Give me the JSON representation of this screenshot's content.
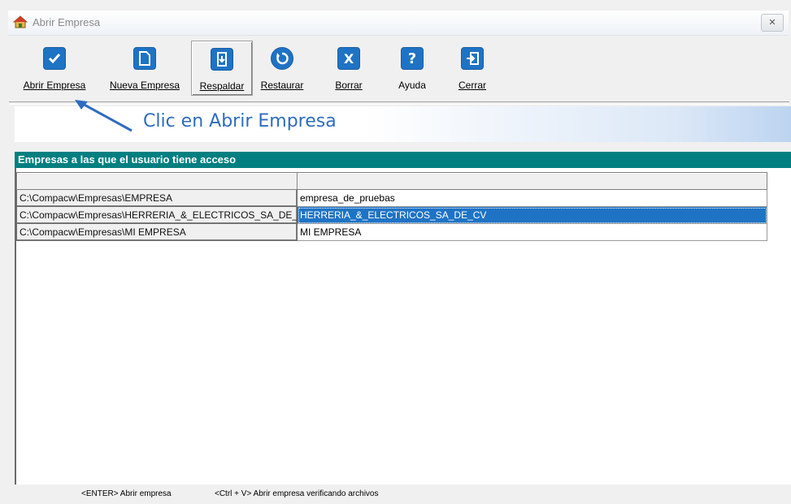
{
  "window": {
    "title": "Abrir Empresa",
    "close_label": "✕"
  },
  "toolbar": {
    "buttons": [
      {
        "label": "Abrir Empresa",
        "icon": "check-icon"
      },
      {
        "label": "Nueva Empresa",
        "icon": "new-document-icon"
      },
      {
        "label": "Respaldar",
        "icon": "backup-icon"
      },
      {
        "label": "Restaurar",
        "icon": "restore-icon"
      },
      {
        "label": "Borrar",
        "icon": "delete-icon"
      },
      {
        "label": "Ayuda",
        "icon": "help-icon"
      },
      {
        "label": "Cerrar",
        "icon": "exit-icon"
      }
    ]
  },
  "annotation": {
    "text": "Clic en Abrir Empresa"
  },
  "panel": {
    "title": "Empresas a las que el usuario tiene acceso"
  },
  "table": {
    "columns": [
      "",
      ""
    ],
    "rows": [
      {
        "path": "C:\\Compacw\\Empresas\\EMPRESA",
        "name": "empresa_de_pruebas",
        "selected": false
      },
      {
        "path": "C:\\Compacw\\Empresas\\HERRERIA_&_ELECTRICOS_SA_DE_CV",
        "name": "HERRERIA_&_ELECTRICOS_SA_DE_CV",
        "selected": true
      },
      {
        "path": "C:\\Compacw\\Empresas\\MI EMPRESA",
        "name": "MI EMPRESA",
        "selected": false
      }
    ]
  },
  "status": {
    "hint1": "<ENTER> Abrir empresa",
    "hint2": "<Ctrl + V> Abrir empresa verificando archivos"
  },
  "colors": {
    "accent": "#1f73c4",
    "panel_header": "#007f80",
    "annotation_text": "#2f6cc0"
  }
}
